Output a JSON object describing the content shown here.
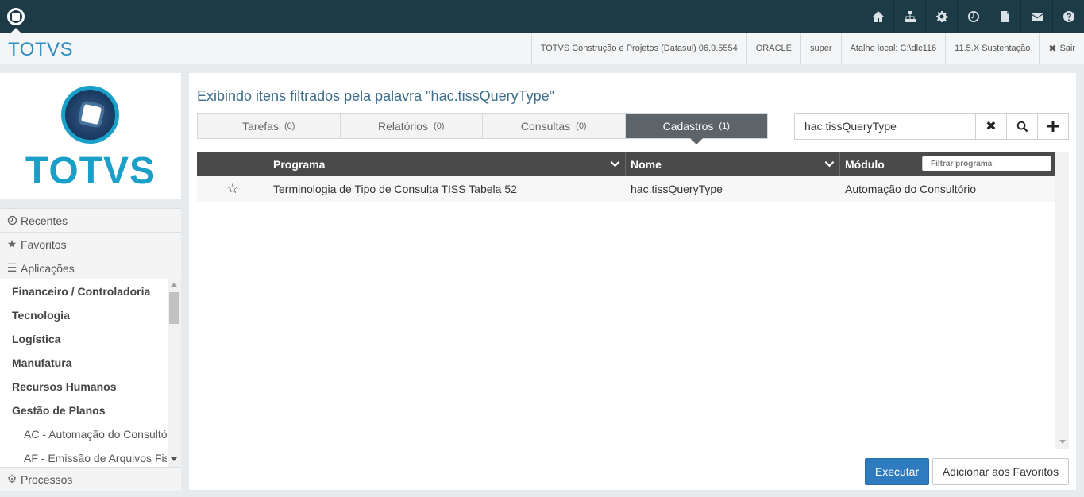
{
  "topbar": {
    "icons": [
      "home-icon",
      "sitemap-icon",
      "gear-icon",
      "clock-icon",
      "document-icon",
      "mail-icon",
      "help-icon"
    ]
  },
  "header": {
    "brand": "TOTVS",
    "product": "TOTVS Construção e Projetos (Datasul) 06.9.5554",
    "database": "ORACLE",
    "user": "super",
    "shortcut": "Atalho local: C:\\dlc116",
    "version": "11.5.X Sustentação",
    "logout": "Sair"
  },
  "sidebar": {
    "logo_text": "TOTVS",
    "recentes": "Recentes",
    "favoritos": "Favoritos",
    "aplicacoes": "Aplicações",
    "apps": [
      "Financeiro / Controladoria",
      "Tecnologia",
      "Logística",
      "Manufatura",
      "Recursos Humanos",
      "Gestão de Planos"
    ],
    "sub_items": [
      "AC - Automação do Consultó",
      "AF - Emissão de Arquivos Fis"
    ],
    "processos": "Processos"
  },
  "main": {
    "title": "Exibindo itens filtrados pela palavra \"hac.tissQueryType\"",
    "tabs": [
      {
        "label": "Tarefas",
        "count": "(0)"
      },
      {
        "label": "Relatórios",
        "count": "(0)"
      },
      {
        "label": "Consultas",
        "count": "(0)"
      },
      {
        "label": "Cadastros",
        "count": "(1)"
      }
    ],
    "search_value": "hac.tissQueryType",
    "grid": {
      "columns": [
        "Programa",
        "Nome",
        "Módulo"
      ],
      "filter_placeholder": "Filtrar programa",
      "rows": [
        {
          "programa": "Terminologia de Tipo de Consulta TISS Tabela 52",
          "nome": "hac.tissQueryType",
          "modulo": "Automação do Consultório"
        }
      ]
    },
    "execute_label": "Executar",
    "add_fav_label": "Adicionar aos Favoritos"
  },
  "colors": {
    "topbar": "#1d3a47",
    "brand": "#2e8fbf",
    "primary_button": "#2f7bbf",
    "active_tab": "#5d6469"
  }
}
